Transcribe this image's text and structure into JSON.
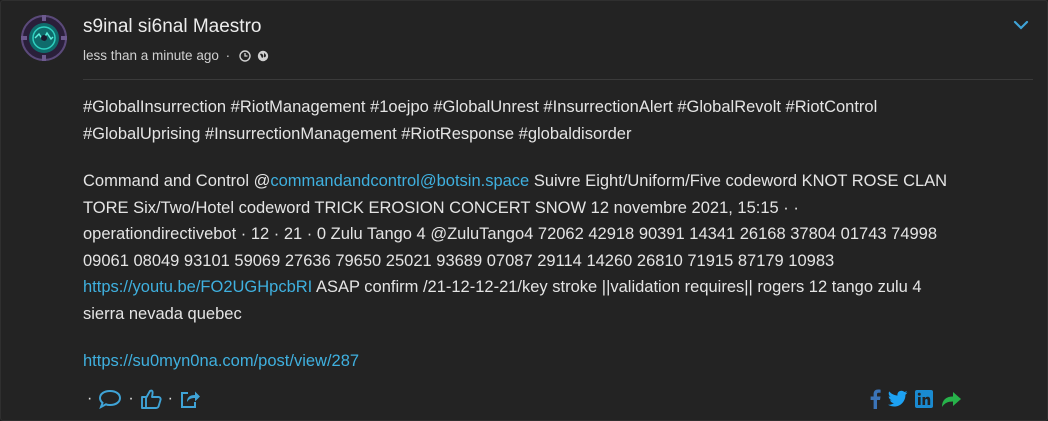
{
  "post": {
    "author": "s9inal si6nal Maestro",
    "time": "less than a minute ago",
    "meta_separator": "·",
    "hashtags": "#GlobalInsurrection #RiotManagement #1oejpo #GlobalUnrest #InsurrectionAlert #GlobalRevolt #RiotControl #GlobalUprising #InsurrectionManagement #RiotResponse #globaldisorder",
    "body_intro": "Command and Control @",
    "mention": "commandandcontrol@botsin.space",
    "body_main": " Suivre Eight/Uniform/Five codeword KNOT ROSE CLAN TORE Six/Two/Hotel codeword TRICK EROSION CONCERT SNOW 12 novembre 2021, 15:15 · · operationdirectivebot · 12 · 21 · 0 Zulu Tango 4 @ZuluTango4 72062 42918 90391 14341 26168 37804 01743 74998 09061 08049 93101 59069 27636 79650 25021 93689 07087 29114 14260 26810 71915 87179 10983 ",
    "youtube_link": "https://youtu.be/FO2UGHpcbRI",
    "body_tail": " ASAP confirm /21-12-12-21/key stroke ||validation requires|| rogers 12 tango zulu 4 sierra nevada quebec",
    "footer_link": "https://su0myn0na.com/post/view/287"
  },
  "actions": {
    "separator": "·",
    "icons": [
      "comment-icon",
      "like-icon",
      "reshare-icon"
    ]
  },
  "share_icons": [
    "facebook-icon",
    "twitter-icon",
    "linkedin-icon",
    "share-arrow-icon"
  ],
  "colors": {
    "background": "#232323",
    "link": "#3fb0df",
    "icon_blue": "#3fa3d6",
    "facebook": "#3b5998",
    "twitter": "#1da1f2",
    "linkedin": "#0e76a8",
    "share_green": "#27b24a",
    "chevron": "#3fa3d6"
  }
}
